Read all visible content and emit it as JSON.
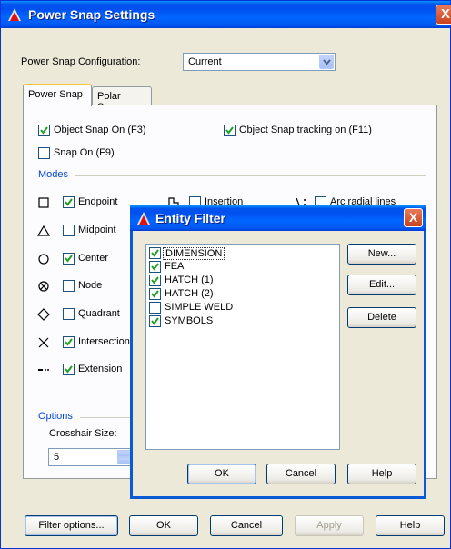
{
  "window": {
    "title": "Power Snap Settings",
    "close": "X"
  },
  "config": {
    "label": "Power Snap Configuration:",
    "value": "Current"
  },
  "tabs": [
    {
      "label": "Power Snap"
    },
    {
      "label": "Polar Snap"
    }
  ],
  "checks": {
    "object_snap_on": {
      "label": "Object Snap On (F3)",
      "checked": true
    },
    "object_snap_tracking": {
      "label": "Object Snap tracking on (F11)",
      "checked": true
    },
    "snap_on": {
      "label": "Snap On (F9)",
      "checked": false
    }
  },
  "modes": {
    "label": "Modes",
    "items": [
      {
        "label": "Endpoint",
        "checked": true,
        "symbol": "square"
      },
      {
        "label": "Midpoint",
        "checked": false,
        "symbol": "triangle"
      },
      {
        "label": "Center",
        "checked": true,
        "symbol": "circle"
      },
      {
        "label": "Node",
        "checked": false,
        "symbol": "node"
      },
      {
        "label": "Quadrant",
        "checked": false,
        "symbol": "diamond"
      },
      {
        "label": "Intersection",
        "checked": true,
        "symbol": "x"
      },
      {
        "label": "Extension",
        "checked": true,
        "symbol": "extension"
      }
    ],
    "insertion": {
      "label": "Insertion",
      "checked": false
    },
    "arc_radial": {
      "label": "Arc radial lines",
      "checked": false
    }
  },
  "options": {
    "label": "Options",
    "crosshair_label": "Crosshair Size:",
    "crosshair_value": "5"
  },
  "buttons": {
    "filter": "Filter options...",
    "ok": "OK",
    "cancel": "Cancel",
    "apply": "Apply",
    "help": "Help"
  },
  "entity_filter": {
    "title": "Entity Filter",
    "close": "X",
    "items": [
      {
        "label": "DIMENSION",
        "checked": true,
        "selected": true
      },
      {
        "label": "FEA",
        "checked": true
      },
      {
        "label": "HATCH (1)",
        "checked": true
      },
      {
        "label": "HATCH (2)",
        "checked": true
      },
      {
        "label": "SIMPLE WELD",
        "checked": false
      },
      {
        "label": "SYMBOLS",
        "checked": true
      }
    ],
    "buttons": {
      "new": "New...",
      "edit": "Edit...",
      "delete": "Delete",
      "ok": "OK",
      "cancel": "Cancel",
      "help": "Help"
    }
  },
  "colors": {
    "title_blue": "#0054e3",
    "group_label": "#0046d5",
    "check_green": "#21a121"
  }
}
